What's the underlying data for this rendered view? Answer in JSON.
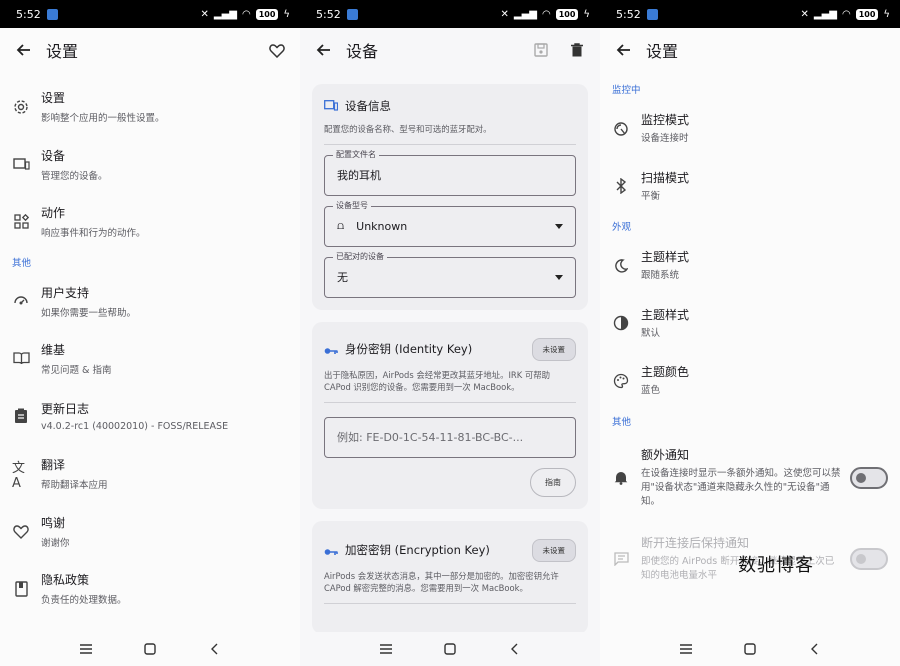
{
  "status": {
    "time": "5:52",
    "battery": "100"
  },
  "screen1": {
    "title": "设置",
    "items": [
      {
        "title": "设置",
        "subtitle": "影响整个应用的一般性设置。"
      },
      {
        "title": "设备",
        "subtitle": "管理您的设备。"
      },
      {
        "title": "动作",
        "subtitle": "响应事件和行为的动作。"
      }
    ],
    "section_other": "其他",
    "other_items": [
      {
        "title": "用户支持",
        "subtitle": "如果你需要一些帮助。"
      },
      {
        "title": "维基",
        "subtitle": "常见问题 & 指南"
      },
      {
        "title": "更新日志",
        "subtitle": "v4.0.2-rc1 (40002010) - FOSS/RELEASE"
      },
      {
        "title": "翻译",
        "subtitle": "帮助翻译本应用"
      },
      {
        "title": "鸣谢",
        "subtitle": "谢谢你"
      },
      {
        "title": "隐私政策",
        "subtitle": "负责任的处理数据。"
      }
    ]
  },
  "screen2": {
    "title": "设备",
    "device_info": {
      "title": "设备信息",
      "desc": "配置您的设备名称、型号和可选的蓝牙配对。",
      "profile_label": "配置文件名",
      "profile_value": "我的耳机",
      "model_label": "设备型号",
      "model_value": "Unknown",
      "paired_label": "已配对的设备",
      "paired_value": "无"
    },
    "identity_key": {
      "title": "身份密钥 (Identity Key)",
      "status": "未设置",
      "desc": "出于隐私原因，AirPods 会经常更改其蓝牙地址。IRK 可帮助 CAPod 识别您的设备。您需要用到一次 MacBook。",
      "placeholder": "例如: FE-D0-1C-54-11-81-BC-BC-...",
      "guide": "指南"
    },
    "encryption_key": {
      "title": "加密密钥 (Encryption Key)",
      "status": "未设置",
      "desc": "AirPods 会发送状态消息，其中一部分是加密的。加密密钥允许 CAPod 解密完整的消息。您需要用到一次 MacBook。"
    }
  },
  "screen3": {
    "title": "设置",
    "section_monitor": "监控中",
    "monitor_items": [
      {
        "title": "监控模式",
        "subtitle": "设备连接时"
      },
      {
        "title": "扫描模式",
        "subtitle": "平衡"
      }
    ],
    "section_appearance": "外观",
    "appearance_items": [
      {
        "title": "主题样式",
        "subtitle": "跟随系统"
      },
      {
        "title": "主题样式",
        "subtitle": "默认"
      },
      {
        "title": "主题颜色",
        "subtitle": "蓝色"
      }
    ],
    "section_other": "其他",
    "extra_notify": {
      "title": "额外通知",
      "subtitle": "在设备连接时显示一条额外通知。这使您可以禁用\"设备状态\"通道来隐藏永久性的\"无设备\"通知。"
    },
    "keep_after_disconnect": {
      "title": "断开连接后保持通知",
      "subtitle": "即使您的 AirPods 断开连接，继续显示上次已知的电池电量水平"
    },
    "watermark": "数驰博客"
  },
  "colors": {
    "accent": "#3a6fd6",
    "surface": "#fbfbfb",
    "card": "#eeeef1"
  }
}
